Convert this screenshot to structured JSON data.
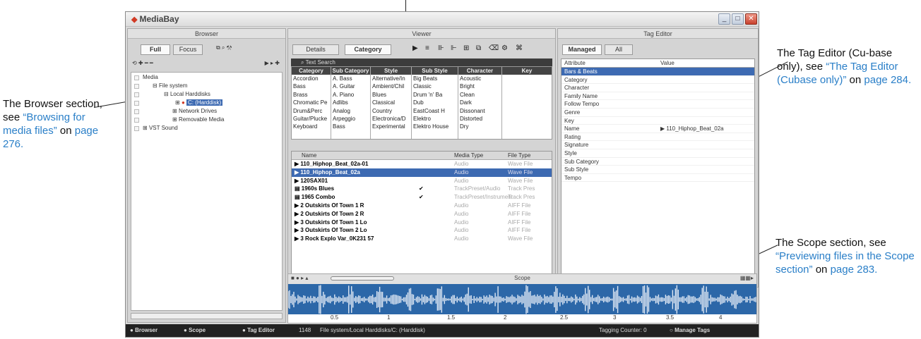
{
  "window": {
    "title": "MediaBay"
  },
  "browser": {
    "header": "Browser",
    "tab_full": "Full",
    "tab_focus": "Focus",
    "tree": [
      "Media",
      "File system",
      "Local Harddisks",
      "C: (Harddisk)",
      "Network Drives",
      "Removable Media",
      "VST Sound"
    ]
  },
  "viewer": {
    "header": "Viewer",
    "tab_details": "Details",
    "tab_category": "Category",
    "text_search": "Text Search",
    "category_columns": [
      {
        "header": "Category",
        "items": [
          "Accordion",
          "Bass",
          "Brass",
          "Chromatic Pe",
          "Drum&Perc",
          "Guitar/Plucke",
          "Keyboard"
        ]
      },
      {
        "header": "Sub Category",
        "items": [
          "A. Bass",
          "A. Guitar",
          "A. Piano",
          "Adlibs",
          "Analog",
          "Arpeggio",
          "Bass"
        ]
      },
      {
        "header": "Style",
        "items": [
          "Alternative/In",
          "Ambient/Chil",
          "Blues",
          "Classical",
          "Country",
          "Electronica/D",
          "Experimental"
        ]
      },
      {
        "header": "Sub Style",
        "items": [
          "Big Beats",
          "Classic",
          "Drum 'n' Ba",
          "Dub",
          "EastCoast H",
          "Elektro",
          "Elektro House"
        ]
      },
      {
        "header": "Character",
        "items": [
          "Acoustic",
          "Bright",
          "Clean",
          "Dark",
          "Dissonant",
          "Distorted",
          "Dry"
        ]
      },
      {
        "header": "Key",
        "items": []
      }
    ],
    "results_columns": [
      "Name",
      "Media Type",
      "File Type"
    ],
    "results": [
      {
        "name": "110_Hiphop_Beat_02a-01",
        "check": "",
        "media": "Audio",
        "file": "Wave File"
      },
      {
        "name": "110_Hiphop_Beat_02a",
        "check": "",
        "media": "Audio",
        "file": "Wave File"
      },
      {
        "name": "120SAX01",
        "check": "",
        "media": "Audio",
        "file": "Wave File"
      },
      {
        "name": "1960s Blues",
        "check": "✔",
        "media": "TrackPreset/Audio",
        "file": "Track Pres"
      },
      {
        "name": "1965 Combo",
        "check": "✔",
        "media": "TrackPreset/Instrument",
        "file": "Track Pres"
      },
      {
        "name": "2 Outskirts Of Town 1 R",
        "check": "",
        "media": "Audio",
        "file": "AIFF File"
      },
      {
        "name": "2 Outskirts Of Town 2 R",
        "check": "",
        "media": "Audio",
        "file": "AIFF File"
      },
      {
        "name": "3 Outskirts Of Town 1 Lo",
        "check": "",
        "media": "Audio",
        "file": "AIFF File"
      },
      {
        "name": "3 Outskirts Of Town 2 Lo",
        "check": "",
        "media": "Audio",
        "file": "AIFF File"
      },
      {
        "name": "3 Rock Explo Var_0K231 57",
        "check": "",
        "media": "Audio",
        "file": "Wave File"
      }
    ]
  },
  "tag_editor": {
    "header": "Tag Editor",
    "tab_managed": "Managed",
    "tab_all": "All",
    "col_attribute": "Attribute",
    "col_value": "Value",
    "rows": [
      {
        "attr": "Bars & Beats",
        "value": ""
      },
      {
        "attr": "Category",
        "value": ""
      },
      {
        "attr": "Character",
        "value": ""
      },
      {
        "attr": "Family Name",
        "value": ""
      },
      {
        "attr": "Follow Tempo",
        "value": ""
      },
      {
        "attr": "Genre",
        "value": ""
      },
      {
        "attr": "Key",
        "value": ""
      },
      {
        "attr": "Name",
        "value": "▶ 110_Hiphop_Beat_02a"
      },
      {
        "attr": "Rating",
        "value": ""
      },
      {
        "attr": "Signature",
        "value": ""
      },
      {
        "attr": "Style",
        "value": ""
      },
      {
        "attr": "Sub Category",
        "value": ""
      },
      {
        "attr": "Sub Style",
        "value": ""
      },
      {
        "attr": "Tempo",
        "value": ""
      }
    ]
  },
  "scope": {
    "header": "Scope",
    "ticks": [
      "0.5",
      "1",
      "1.5",
      "2",
      "2.5",
      "3",
      "3.5",
      "4"
    ]
  },
  "status": {
    "browser": "Browser",
    "scope": "Scope",
    "tag_editor": "Tag Editor",
    "count": "1148",
    "path": "File system/Local Harddisks/C: (Harddisk)",
    "tagging_counter": "Tagging Counter: 0",
    "manage_tags": "Manage Tags"
  },
  "callouts": {
    "browser": {
      "text": "The Browser section, see",
      "link": "“Browsing for media files”",
      "tail": "on",
      "page": "page 276."
    },
    "tag_editor": {
      "text": "The Tag Editor (Cu-base only), see",
      "link": "“The Tag Editor (Cubase only)”",
      "tail": "on",
      "page": "page 284."
    },
    "scope": {
      "text": "The Scope section, see",
      "link": "“Previewing files in the Scope section”",
      "tail": "on",
      "page": "page 283."
    }
  }
}
